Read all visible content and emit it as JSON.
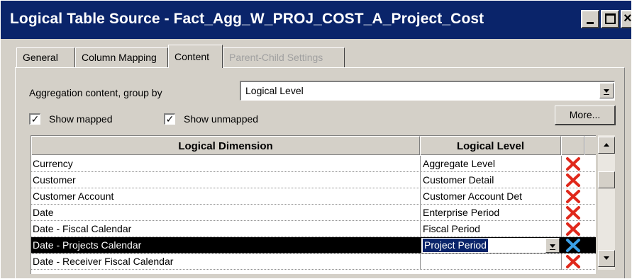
{
  "window": {
    "title": "Logical Table Source - Fact_Agg_W_PROJ_COST_A_Project_Cost"
  },
  "tabs": [
    {
      "label": "General",
      "state": "normal"
    },
    {
      "label": "Column Mapping",
      "state": "normal"
    },
    {
      "label": "Content",
      "state": "active"
    },
    {
      "label": "Parent-Child Settings",
      "state": "disabled"
    }
  ],
  "content": {
    "aggregation_label": "Aggregation content, group by",
    "aggregation_value": "Logical Level",
    "show_mapped": {
      "label": "Show mapped",
      "checked": true,
      "mark": "✓"
    },
    "show_unmapped": {
      "label": "Show unmapped",
      "checked": true,
      "mark": "✓"
    },
    "more_label": "More..."
  },
  "grid": {
    "columns": {
      "dimension": "Logical Dimension",
      "level": "Logical Level"
    },
    "rows": [
      {
        "dimension": "Currency",
        "level": "Aggregate Level",
        "selected": false
      },
      {
        "dimension": "Customer",
        "level": "Customer Detail",
        "selected": false
      },
      {
        "dimension": "Customer Account",
        "level": "Customer Account Det",
        "selected": false
      },
      {
        "dimension": "Date",
        "level": "Enterprise Period",
        "selected": false
      },
      {
        "dimension": "Date - Fiscal Calendar",
        "level": "Fiscal Period",
        "selected": false
      },
      {
        "dimension": "Date - Projects Calendar",
        "level": "Project Period",
        "selected": true
      },
      {
        "dimension": "Date - Receiver Fiscal Calendar",
        "level": "",
        "selected": false
      }
    ],
    "delete_icon": "red-x-delete-icon"
  },
  "colors": {
    "titlebar": "#0a246a",
    "face": "#d4d0c8",
    "delete_red": "#e0281b",
    "delete_selected": "#3aa0e8"
  }
}
